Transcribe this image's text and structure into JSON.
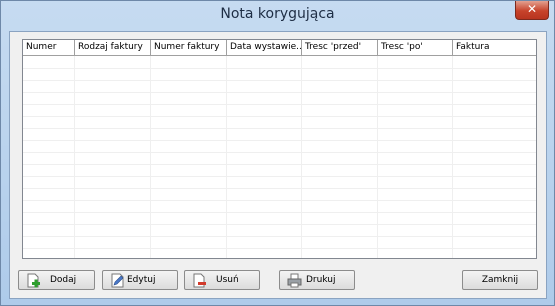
{
  "window": {
    "title": "Nota korygująca",
    "close_glyph": "✕"
  },
  "grid": {
    "columns": [
      "Numer",
      "Rodzaj faktury",
      "Numer faktury",
      "Data wystawie...",
      "Tresc 'przed'",
      "Tresc 'po'",
      "Faktura"
    ],
    "rows": []
  },
  "buttons": {
    "add": {
      "label": "Dodaj",
      "icon": "add-document-icon"
    },
    "edit": {
      "label": "Edytuj",
      "icon": "edit-pencil-icon"
    },
    "delete": {
      "label": "Usuń",
      "icon": "delete-document-icon"
    },
    "print": {
      "label": "Drukuj",
      "icon": "printer-icon"
    },
    "close": {
      "label": "Zamknij"
    }
  },
  "colors": {
    "accent_green": "#2e9e2e",
    "accent_red": "#d23b2c",
    "window_frame": "#aecbea"
  }
}
